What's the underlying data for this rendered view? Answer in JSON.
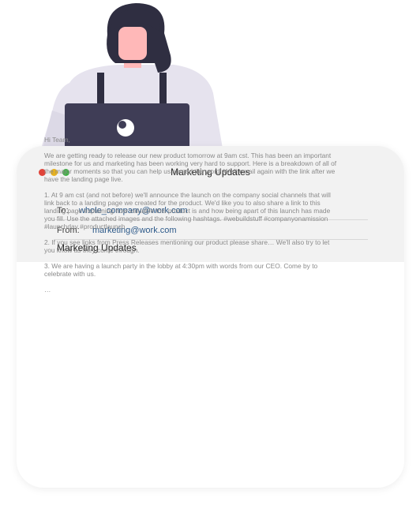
{
  "window": {
    "title": "Marketing Updates"
  },
  "email": {
    "to_label": "To:",
    "to_value": "whole_company@work.com",
    "from_label": "From:",
    "from_value": "marketing@work.com",
    "subject": "Marketing Updates",
    "body": {
      "greeting": "Hi Team,",
      "paragraphs": [
        "We are getting ready to release our new product tomorrow at 9am cst. This has been an important milestone for us and marketing has been working very hard to support. Here is a breakdown of all of the major moments so that you can help us spread the word! We'll email again with the link after we have the landing page live.",
        "1. At 9 am cst (and not before) we'll announce the launch on the company social channels that will link back to a landing page we created for the product. We'd like you to also share a link to this landing page explaining how valuable this product is and how being apart of this launch has made you fill. Use the attached images and the following hashtags. #webuildstuff #companyonamission #launchday #productlaunch",
        "2. If you see links from Press Releases mentioning our product please share… We'll also try to let you know as they come through.",
        "3. We are having a launch party in the lobby at 4:30pm with words from our CEO. Come by to celebrate with us."
      ],
      "ellipsis": "…"
    }
  }
}
